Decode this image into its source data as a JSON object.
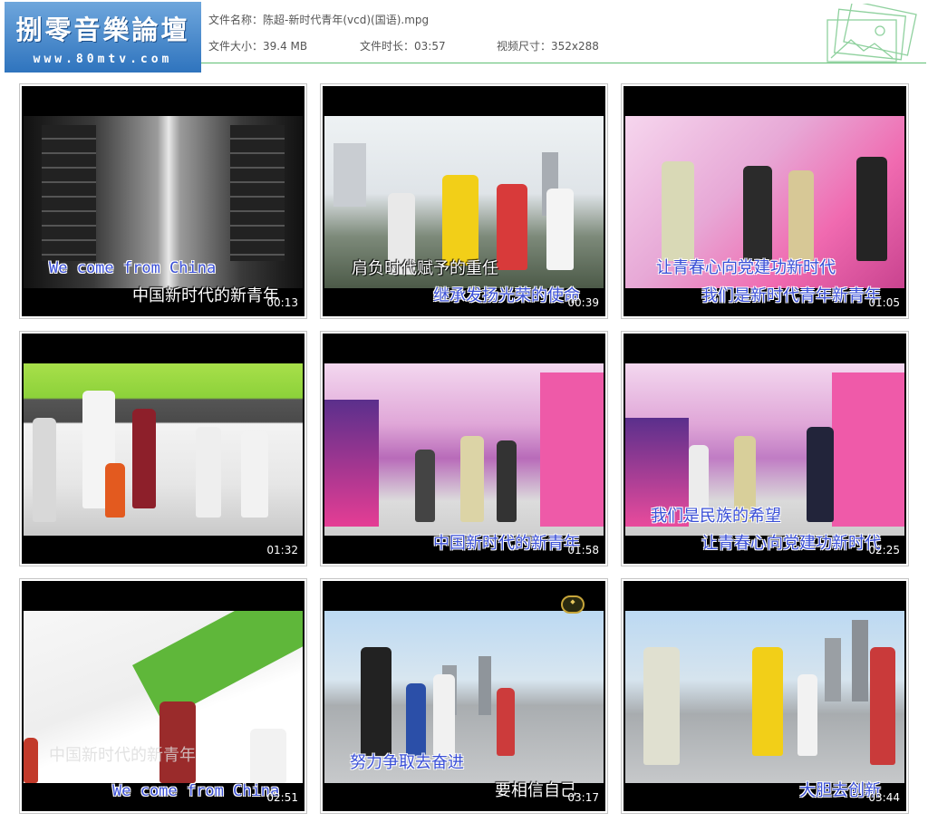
{
  "header": {
    "logo_title": "捌零音樂論壇",
    "logo_url": "www.80mtv.com",
    "file_name_label": "文件名称：",
    "file_name": "陈超-新时代青年(vcd)(国语).mpg",
    "file_size_label": "文件大小：",
    "file_size": "39.4 MB",
    "duration_label": "文件时长：",
    "duration": "03:57",
    "dimensions_label": "视频尺寸：",
    "dimensions": "352x288",
    "accent_color": "#5fbf73",
    "logo_color": "#3b80c6"
  },
  "thumbnails": [
    {
      "time": "00:13",
      "caption_top": "We come from China",
      "caption_bottom": "中国新时代的新青年"
    },
    {
      "time": "00:39",
      "caption_top": "肩负时代赋予的重任",
      "caption_bottom": "继承发扬光荣的使命"
    },
    {
      "time": "01:05",
      "caption_top": "让青春心向党建功新时代",
      "caption_bottom": "我们是新时代青年新青年"
    },
    {
      "time": "01:32",
      "caption_top": "",
      "caption_bottom": ""
    },
    {
      "time": "01:58",
      "caption_top": "",
      "caption_bottom": "中国新时代的新青年"
    },
    {
      "time": "02:25",
      "caption_top": "我们是民族的希望",
      "caption_bottom": "让青春心向党建功新时代"
    },
    {
      "time": "02:51",
      "caption_top": "中国新时代的新青年",
      "caption_bottom": "We come from China"
    },
    {
      "time": "03:17",
      "caption_top": "努力争取去奋进",
      "caption_bottom": "要相信自己"
    },
    {
      "time": "03:44",
      "caption_top": "",
      "caption_bottom": "大胆去创新"
    }
  ]
}
